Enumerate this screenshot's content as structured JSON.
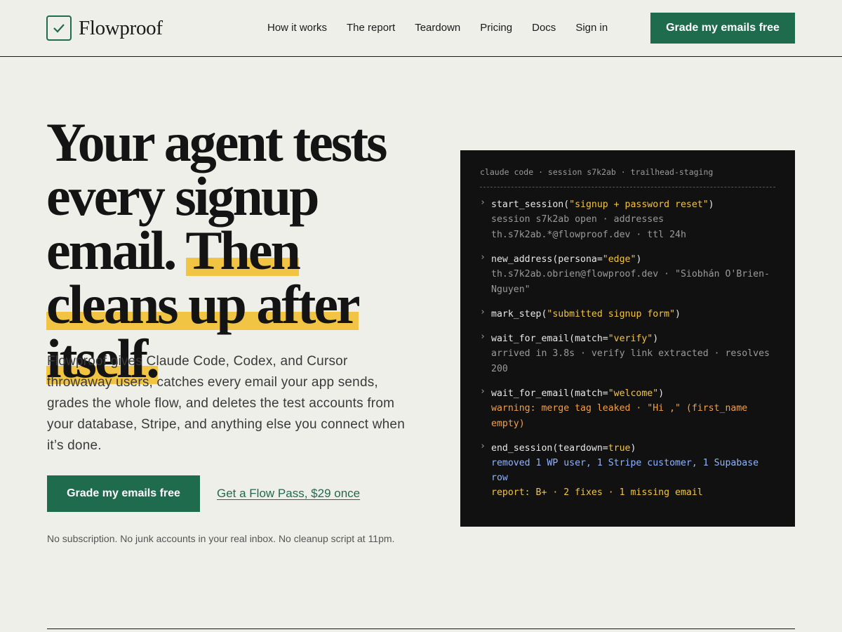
{
  "brand": {
    "name": "Flowproof",
    "icon": "check-icon",
    "accent": "#1f6b4d",
    "highlight": "#f2c443"
  },
  "nav": {
    "items": [
      "How it works",
      "The report",
      "Teardown",
      "Pricing",
      "Docs",
      "Sign in"
    ],
    "cta": "Grade my emails free"
  },
  "hero": {
    "headline_plain": "Your agent tests every signup email.",
    "headline_highlight": "Then cleans up after itself.",
    "lead": "Flowproof gives Claude Code, Codex, and Cursor throwaway users, catches every email your app sends, grades the whole flow, and deletes the test accounts from your database, Stripe, and anything else you connect when it’s done.",
    "cta_primary": "Grade my emails free",
    "cta_secondary": "Get a Flow Pass, $29 once",
    "fineprint": "No subscription. No junk accounts in your real inbox. No cleanup script at 11pm."
  },
  "terminal": {
    "header": "claude code · session s7k2ab · trailhead-staging",
    "prompt": "›",
    "commands": [
      {
        "fn": "start_session(",
        "arg": "\"signup + password reset\"",
        "close": ")",
        "output": "session s7k2ab open · addresses th.s7k2ab.*@flowproof.dev · ttl 24h"
      },
      {
        "fn": "new_address(persona=",
        "arg": "\"edge\"",
        "close": ")",
        "output": "th.s7k2ab.obrien@flowproof.dev · \"Siobhán O'Brien-Nguyen\""
      },
      {
        "fn": "mark_step(",
        "arg": "\"submitted signup form\"",
        "close": ")",
        "output": ""
      },
      {
        "fn": "wait_for_email(match=",
        "arg": "\"verify\"",
        "close": ")",
        "output": "arrived in 3.8s · verify link extracted · resolves 200"
      },
      {
        "fn": "wait_for_email(match=",
        "arg": "\"welcome\"",
        "close": ")",
        "warning": "warning: merge tag leaked · \"Hi ,\" (first_name empty)"
      },
      {
        "fn": "end_session(teardown=",
        "arg": "true",
        "close": ")",
        "removed": "removed 1 WP user, 1 Stripe customer, 1 Supabase row",
        "report": "report: B+ · 2 fixes · 1 missing email"
      }
    ]
  }
}
